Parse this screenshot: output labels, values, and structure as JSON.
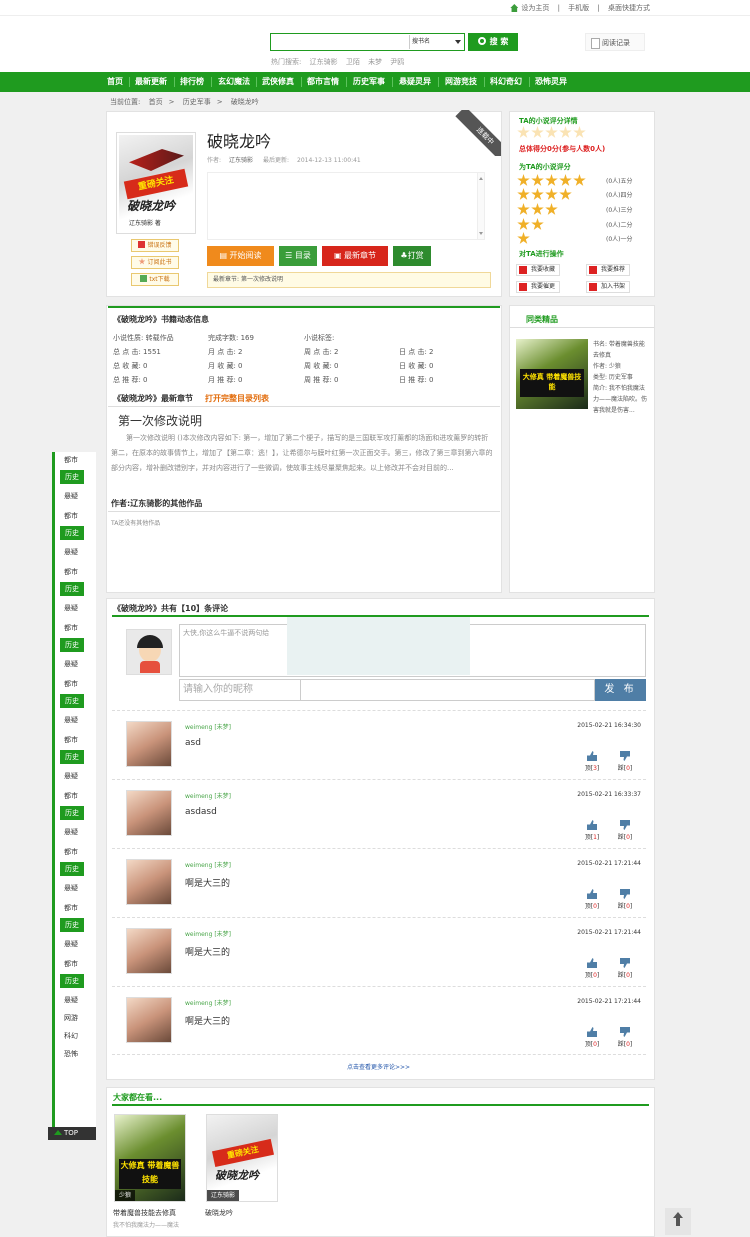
{
  "top_util": {
    "set_home": "设为主页",
    "mobile": "手机版",
    "desktop": "桌面快捷方式"
  },
  "search": {
    "placeholder": "",
    "select_value": "搜书名",
    "button": "搜 索",
    "hot_label": "热门搜索:",
    "hot_words": [
      "辽东骑影",
      "卫陌",
      "未梦",
      "尹鸥"
    ]
  },
  "read_record": "阅读记录",
  "nav": [
    "首页",
    "最新更新",
    "排行榜",
    "玄幻魔法",
    "武侠修真",
    "都市言情",
    "历史军事",
    "悬疑灵异",
    "网游竞技",
    "科幻奇幻",
    "恐怖灵异"
  ],
  "breadcrumb": {
    "label": "当前位置:",
    "items": [
      "首页",
      "历史军事",
      "破晓龙吟"
    ]
  },
  "book": {
    "title": "破晓龙吟",
    "author_label": "作者:",
    "author": "辽东骑影",
    "updated_label": "最后更新:",
    "updated": "2014-12-13 11:00:41",
    "status_ribbon": "连载中",
    "cover_red_text": "重磅关注",
    "cover_title": "破晓龙吟",
    "cover_sub": "辽东骑影 著",
    "small_buttons": [
      "错误反馈",
      "订阅此书",
      "txt下载"
    ],
    "actions": [
      "开始阅读",
      "目录",
      "最新章节",
      "打赏"
    ],
    "latest_label": "最新章节:",
    "latest_chapter": "第一次修改说明"
  },
  "rating": {
    "title": "TA的小说评分详情",
    "total": "总体得分0分(参与人数0人)",
    "rate_title": "为TA的小说评分",
    "rows": [
      {
        "stars": 5,
        "label": "(0人)五分"
      },
      {
        "stars": 4,
        "label": "(0人)四分"
      },
      {
        "stars": 3,
        "label": "(0人)三分"
      },
      {
        "stars": 2,
        "label": "(0人)二分"
      },
      {
        "stars": 1,
        "label": "(0人)一分"
      }
    ],
    "ops_title": "对TA进行操作",
    "ops": [
      "我要收藏",
      "我要推荐",
      "我要催更",
      "加入书架"
    ]
  },
  "dynamic": {
    "title": "《破晓龙吟》书籍动态信息",
    "rows": [
      [
        "小说性质: 转载作品",
        "完成字数: 169",
        "小说标签:",
        ""
      ],
      [
        "总 点 击: 1551",
        "月 点 击: 2",
        "周 点 击: 2",
        "日 点 击: 2"
      ],
      [
        "总 收 藏: 0",
        "月 收 藏: 0",
        "周 收 藏: 0",
        "日 收 藏: 0"
      ],
      [
        "总 推 荐: 0",
        "月 推 荐: 0",
        "周 推 荐: 0",
        "日 推 荐: 0"
      ]
    ],
    "latest_title": "《破晓龙吟》最新章节",
    "open_list": "打开完整目录列表",
    "chapter_title": "第一次修改说明",
    "chapter_text": "第一次修改说明 ()本次修改内容如下: 第一，增加了第二个梗子，描写的是三国联军攻打薰都的场面和进攻薰罗的转折 第二，在原本的故事情节上，增加了【第二章：逃！】，让希德尔与膜叶红第一次正面交手。第三，修改了第三章到第六章的部分内容，增补删改错别字，并对内容进行了一些微调，使故事主线尽量聚焦起来。以上修改并不会对目前的...",
    "other_works_title": "作者:辽东骑影的其他作品",
    "other_works_text": "TA还没有其他作品"
  },
  "similar": {
    "title": "同类精品",
    "cover_text": "大修真\n带着魔兽技能",
    "info": [
      "书名: 带着魔兽技能去修真",
      "作者: 少狼",
      "类型: 历史军事",
      "简介: 我不怕我魔法力——魔法陷吹。伤害我就是伤害..."
    ]
  },
  "comments_section": {
    "title": "《破晓龙吟》共有【10】条评论",
    "textarea_placeholder": "大侠,你这么牛逼不说两句给",
    "nick_placeholder": "请输入你的昵称",
    "publish": "发 布",
    "items": [
      {
        "user": "weimeng [未梦]",
        "time": "2015-02-21 16:34:30",
        "text": "asd",
        "ding": "顶[3]",
        "cai": "踩[0]"
      },
      {
        "user": "weimeng [未梦]",
        "time": "2015-02-21 16:33:37",
        "text": "asdasd",
        "ding": "顶[1]",
        "cai": "踩[0]"
      },
      {
        "user": "weimeng [未梦]",
        "time": "2015-02-21 17:21:44",
        "text": "啊是大三的",
        "ding": "顶[0]",
        "cai": "踩[0]"
      },
      {
        "user": "weimeng [未梦]",
        "time": "2015-02-21 17:21:44",
        "text": "啊是大三的",
        "ding": "顶[0]",
        "cai": "踩[0]"
      },
      {
        "user": "weimeng [未梦]",
        "time": "2015-02-21 17:21:44",
        "text": "啊是大三的",
        "ding": "顶[0]",
        "cai": "踩[0]"
      }
    ],
    "more": "点击查看更多评论>>>"
  },
  "side_nav": [
    [
      "都市",
      "历史",
      "悬疑"
    ],
    [
      "都市",
      "历史",
      "悬疑"
    ],
    [
      "都市",
      "历史",
      "悬疑"
    ],
    [
      "都市",
      "历史",
      "悬疑"
    ],
    [
      "都市",
      "历史",
      "悬疑"
    ],
    [
      "都市",
      "历史",
      "悬疑"
    ],
    [
      "都市",
      "历史",
      "悬疑"
    ],
    [
      "都市",
      "历史",
      "悬疑"
    ],
    [
      "都市",
      "历史",
      "悬疑"
    ],
    [
      "都市",
      "历史",
      "悬疑",
      "网游",
      "科幻",
      "恐怖"
    ]
  ],
  "side_top": "TOP",
  "everyone_reading": {
    "title": "大家都在看...",
    "books": [
      {
        "tag": "少狼",
        "name": "带着魔兽技能去修真",
        "desc": "我不怕我魔法力——魔法"
      },
      {
        "tag": "辽东骑影",
        "name": "破晓龙吟",
        "desc": ""
      }
    ]
  },
  "back_top": "回顶部",
  "colors": {
    "brand_green": "#1f9b1f",
    "accent_orange": "#f08a1c",
    "accent_red": "#d7261b"
  }
}
